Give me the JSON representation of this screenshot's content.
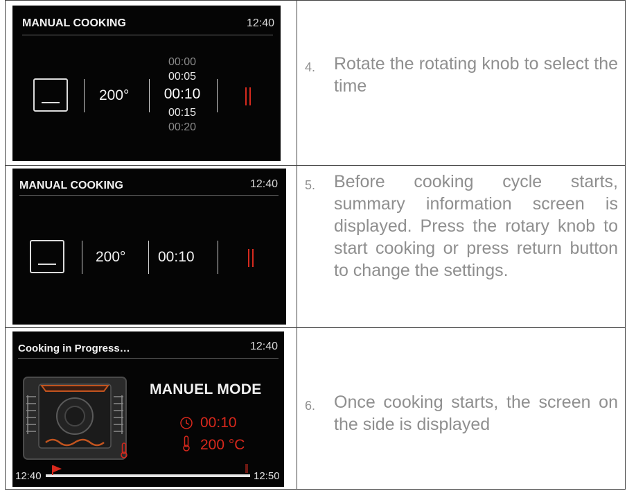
{
  "rows": [
    {
      "screen": {
        "title": "MANUAL COOKING",
        "clock": "12:40",
        "temperature": "200°",
        "time_options": [
          "00:00",
          "00:05",
          "00:10",
          "00:15",
          "00:20"
        ],
        "pause_icon": "pause-icon"
      },
      "step_number": "4.",
      "step_text": "Rotate the rotating knob to select the time"
    },
    {
      "screen": {
        "title": "MANUAL COOKING",
        "clock": "12:40",
        "temperature": "200°",
        "time": "00:10",
        "pause_icon": "pause-icon"
      },
      "step_number": "5.",
      "step_text": "Before cooking cycle starts, summary information screen is displayed. Press the rotary knob to start cooking or press return button to change the settings."
    },
    {
      "screen": {
        "title": "Cooking in Progress…",
        "clock": "12:40",
        "mode": "MANUEL MODE",
        "time": "00:10",
        "temperature": "200 °C",
        "start_time": "12:40",
        "end_time": "12:50",
        "progress": 0.03
      },
      "step_number": "6.",
      "step_text": "Once cooking starts, the screen on the side is displayed"
    }
  ],
  "colors": {
    "screen_bg": "#050505",
    "accent_red": "#d8281c",
    "instruction_text": "#8f8f8f"
  }
}
